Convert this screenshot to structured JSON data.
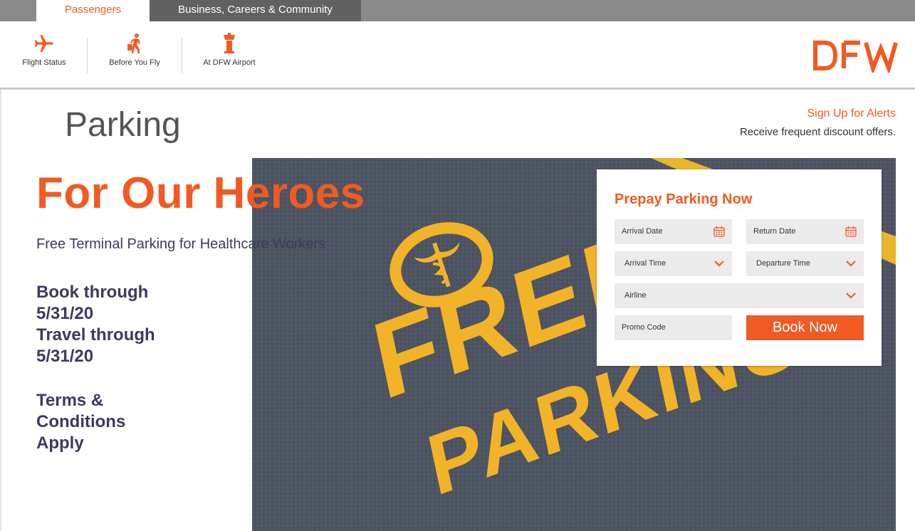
{
  "tabs": {
    "passengers": "Passengers",
    "business": "Business, Careers & Community"
  },
  "nav": {
    "flight_status": "Flight Status",
    "before_you_fly": "Before You Fly",
    "at_dfw_airport": "At DFW Airport"
  },
  "logo_text": "DFW",
  "page_title": "Parking",
  "alerts": {
    "link": "Sign Up for Alerts",
    "sub": "Receive frequent discount offers."
  },
  "hero": {
    "heading": "For Our Heroes",
    "subheading": "Free Terminal Parking for Healthcare Workers",
    "offer_lines": [
      "Book through",
      "5/31/20",
      "Travel through",
      "5/31/20"
    ],
    "terms_lines": [
      "Terms &",
      "Conditions",
      "Apply"
    ],
    "image_text_1": "FREE",
    "image_text_2": "PARKING"
  },
  "booking": {
    "title": "Prepay Parking Now",
    "arrival_date": "Arrival Date",
    "return_date": "Return Date",
    "arrival_time": "Arrival Time",
    "departure_time": "Departure Time",
    "airline": "Airline",
    "promo_code": "Promo Code",
    "book_button": "Book Now"
  },
  "icons": {
    "flight_status": "plane-icon",
    "before_you_fly": "traveler-icon",
    "at_dfw_airport": "tower-icon",
    "date": "calendar-icon",
    "select": "chevron-down-icon"
  },
  "colors": {
    "brand_orange": "#f15a22",
    "text_dark": "#3d3a5c",
    "tab_bar": "#8a8a8a",
    "tab_active_bg": "#616161",
    "field_bg": "#ebebeb"
  }
}
